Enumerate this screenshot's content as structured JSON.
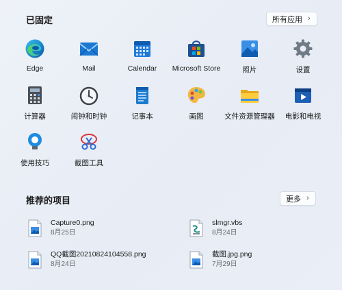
{
  "pinned": {
    "title": "已固定",
    "all_apps_label": "所有应用",
    "apps": [
      {
        "label": "Edge",
        "icon": "edge-icon"
      },
      {
        "label": "Mail",
        "icon": "mail-icon"
      },
      {
        "label": "Calendar",
        "icon": "calendar-icon"
      },
      {
        "label": "Microsoft Store",
        "icon": "store-icon"
      },
      {
        "label": "照片",
        "icon": "photos-icon"
      },
      {
        "label": "设置",
        "icon": "gear-icon"
      },
      {
        "label": "计算器",
        "icon": "calculator-icon"
      },
      {
        "label": "闹钟和时钟",
        "icon": "clock-icon"
      },
      {
        "label": "记事本",
        "icon": "notepad-icon"
      },
      {
        "label": "画图",
        "icon": "paint-icon"
      },
      {
        "label": "文件资源管理器",
        "icon": "folder-icon"
      },
      {
        "label": "电影和电视",
        "icon": "movies-icon"
      },
      {
        "label": "使用技巧",
        "icon": "tips-icon"
      },
      {
        "label": "截图工具",
        "icon": "snipping-tool-icon"
      }
    ]
  },
  "recommended": {
    "title": "推荐的项目",
    "more_label": "更多",
    "items": [
      {
        "name": "Capture0.png",
        "date": "8月25日",
        "icon": "image-file-icon"
      },
      {
        "name": "slmgr.vbs",
        "date": "8月24日",
        "icon": "script-file-icon"
      },
      {
        "name": "QQ截图20210824104558.png",
        "date": "8月24日",
        "icon": "image-file-icon"
      },
      {
        "name": "截图.jpg.png",
        "date": "7月29日",
        "icon": "image-file-icon"
      }
    ]
  }
}
